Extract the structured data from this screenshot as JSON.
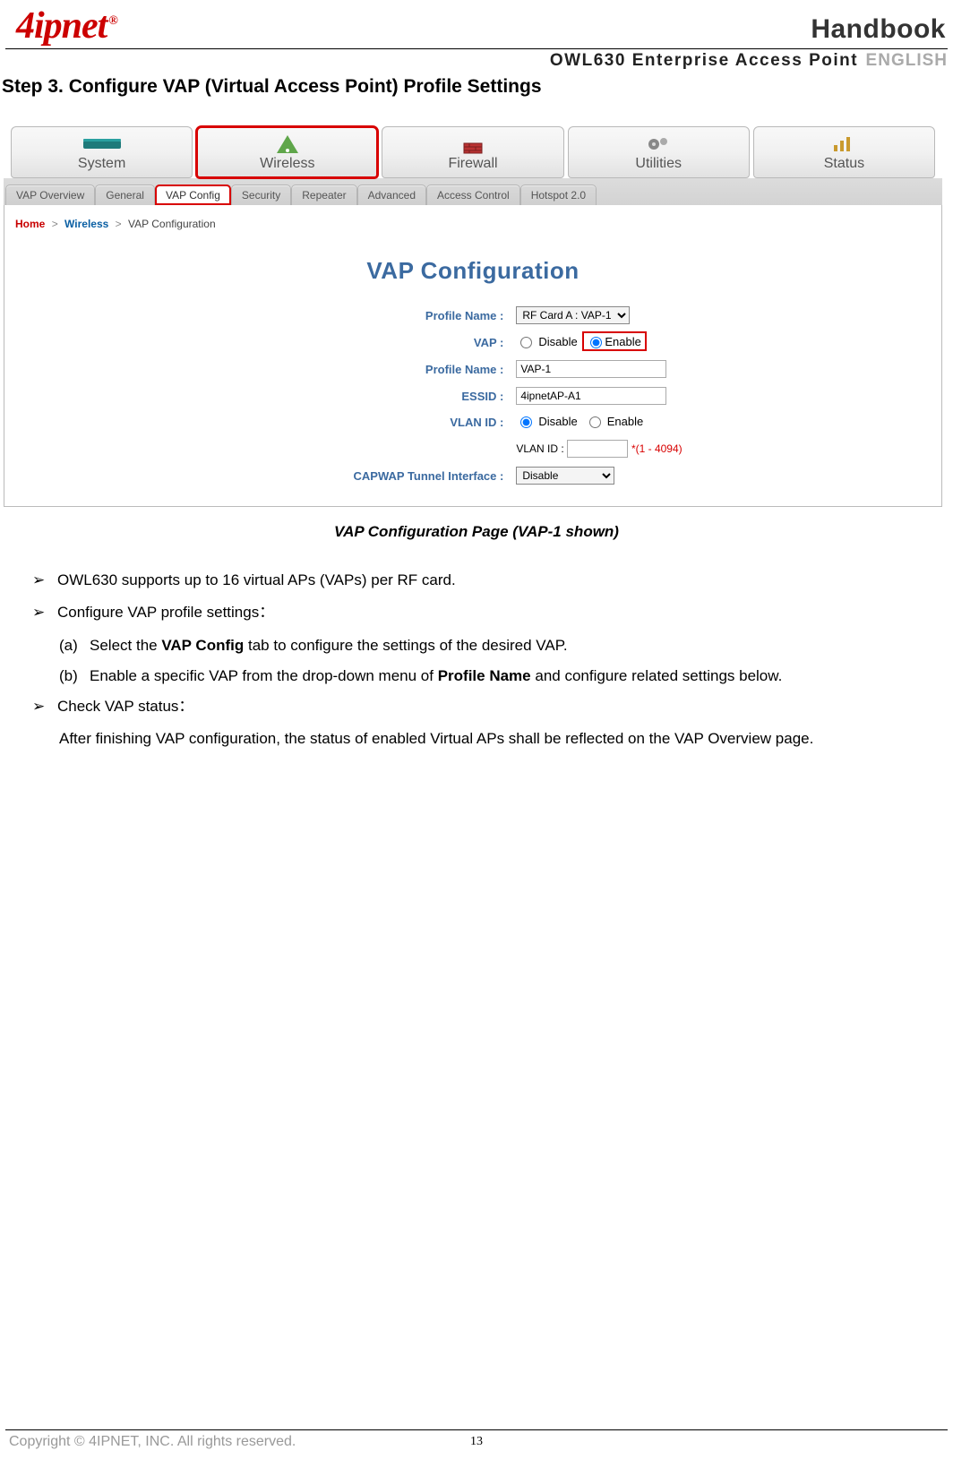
{
  "header": {
    "logo_text": "4ipnet",
    "logo_reg": "®",
    "handbook_label": "Handbook",
    "subtitle_main": "OWL630 Enterprise Access Point",
    "subtitle_lang": "ENGLISH"
  },
  "step_title": "Step 3. Configure VAP (Virtual Access Point) Profile Settings",
  "screenshot": {
    "main_tabs": [
      {
        "label": "System",
        "icon": "router-icon"
      },
      {
        "label": "Wireless",
        "icon": "wifi-icon",
        "active": true
      },
      {
        "label": "Firewall",
        "icon": "firewall-icon"
      },
      {
        "label": "Utilities",
        "icon": "gears-icon"
      },
      {
        "label": "Status",
        "icon": "chart-icon"
      }
    ],
    "sub_tabs": [
      {
        "label": "VAP Overview"
      },
      {
        "label": "General"
      },
      {
        "label": "VAP Config",
        "active": true
      },
      {
        "label": "Security"
      },
      {
        "label": "Repeater"
      },
      {
        "label": "Advanced"
      },
      {
        "label": "Access Control"
      },
      {
        "label": "Hotspot 2.0"
      }
    ],
    "breadcrumb": {
      "home": "Home",
      "section": "Wireless",
      "page": "VAP Configuration"
    },
    "panel_title": "VAP Configuration",
    "form": {
      "profile_select_label": "Profile Name :",
      "profile_select_value": "RF Card A : VAP-1",
      "vap_label": "VAP :",
      "vap_disable": "Disable",
      "vap_enable": "Enable",
      "profile_name_label": "Profile Name :",
      "profile_name_value": "VAP-1",
      "essid_label": "ESSID :",
      "essid_value": "4ipnetAP-A1",
      "vlan_label": "VLAN ID :",
      "vlan_disable": "Disable",
      "vlan_enable": "Enable",
      "vlan_id_sublabel": "VLAN ID :",
      "vlan_id_value": "",
      "vlan_note": "*(1 - 4094)",
      "capwap_label": "CAPWAP Tunnel Interface :",
      "capwap_value": "Disable"
    }
  },
  "caption": "VAP Configuration Page (VAP-1 shown)",
  "body": {
    "bullet_glyph": "➢",
    "items": [
      {
        "text": "OWL630 supports up to 16 virtual APs (VAPs) per RF card."
      },
      {
        "text": "Configure VAP profile settings：",
        "sub": [
          {
            "label": "(a)",
            "html_parts": [
              "Select the ",
              "VAP Config",
              " tab to configure the settings of the desired VAP."
            ]
          },
          {
            "label": "(b)",
            "html_parts": [
              "Enable a specific VAP from the drop-down menu of ",
              "Profile Name",
              " and configure related settings below."
            ]
          }
        ]
      },
      {
        "text": "Check VAP status：",
        "tail": "After finishing VAP configuration, the status of enabled Virtual APs shall be reflected on the VAP Overview page."
      }
    ]
  },
  "footer": {
    "copyright": "Copyright © 4IPNET, INC. All rights reserved.",
    "page_number": "13"
  }
}
